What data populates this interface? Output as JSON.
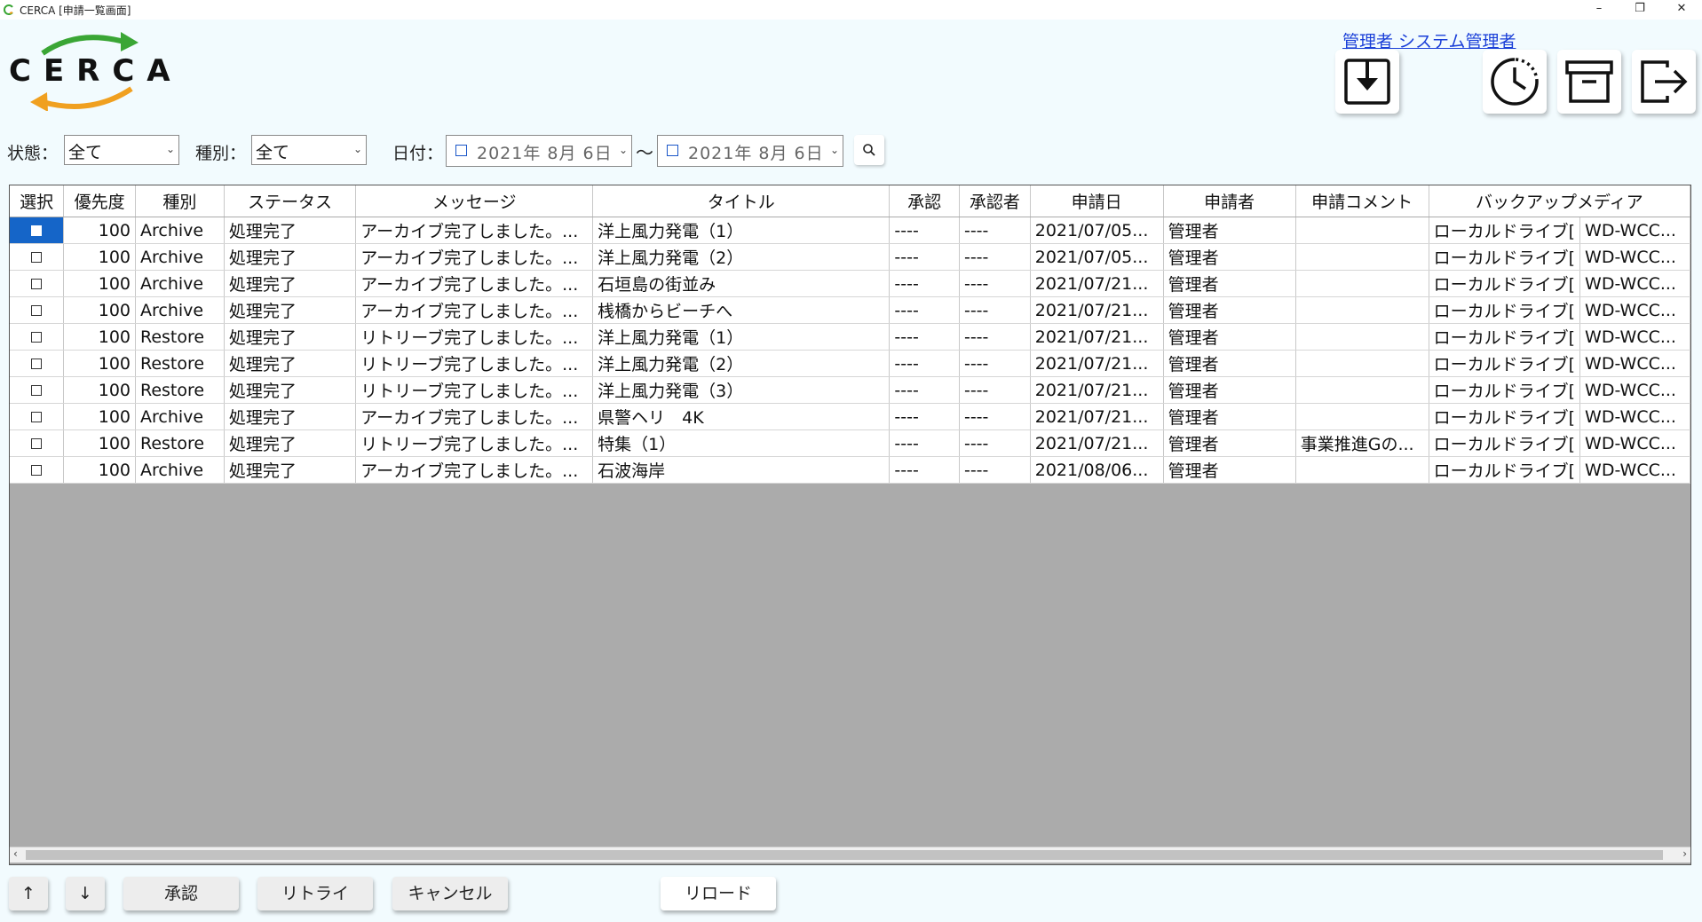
{
  "window": {
    "title": "CERCA [申請一覧画面]",
    "minimize_glyph": "–",
    "maximize_glyph": "❐",
    "close_glyph": "✕"
  },
  "logo": {
    "text": "CERCA"
  },
  "user": {
    "link": "管理者 システム管理者"
  },
  "toolbar": {
    "icons": [
      "download-icon",
      "history-icon",
      "archive-box-icon",
      "logout-icon"
    ]
  },
  "filters": {
    "status_label": "状態：",
    "status_value": "全て",
    "type_label": "種別：",
    "type_value": "全て",
    "date_label": "日付：",
    "date_from": "2021年  8月  6日",
    "date_sep": "〜",
    "date_to": "2021年  8月  6日"
  },
  "table": {
    "columns": [
      "選択",
      "優先度",
      "種別",
      "ステータス",
      "メッセージ",
      "タイトル",
      "承認",
      "承認者",
      "申請日",
      "申請者",
      "申請コメント",
      "バックアップメディア"
    ],
    "rows": [
      [
        "100",
        "Archive",
        "処理完了",
        "アーカイブ完了しました。...",
        "洋上風力発電（1）",
        "----",
        "----",
        "2021/07/05...",
        "管理者",
        "",
        "ローカルドライブ[",
        "WD-WCC..."
      ],
      [
        "100",
        "Archive",
        "処理完了",
        "アーカイブ完了しました。...",
        "洋上風力発電（2）",
        "----",
        "----",
        "2021/07/05...",
        "管理者",
        "",
        "ローカルドライブ[",
        "WD-WCC..."
      ],
      [
        "100",
        "Archive",
        "処理完了",
        "アーカイブ完了しました。...",
        "石垣島の街並み",
        "----",
        "----",
        "2021/07/21...",
        "管理者",
        "",
        "ローカルドライブ[",
        "WD-WCC..."
      ],
      [
        "100",
        "Archive",
        "処理完了",
        "アーカイブ完了しました。...",
        "桟橋からビーチへ",
        "----",
        "----",
        "2021/07/21...",
        "管理者",
        "",
        "ローカルドライブ[",
        "WD-WCC..."
      ],
      [
        "100",
        "Restore",
        "処理完了",
        "リトリーブ完了しました。...",
        "洋上風力発電（1）",
        "----",
        "----",
        "2021/07/21...",
        "管理者",
        "",
        "ローカルドライブ[",
        "WD-WCC..."
      ],
      [
        "100",
        "Restore",
        "処理完了",
        "リトリーブ完了しました。...",
        "洋上風力発電（2）",
        "----",
        "----",
        "2021/07/21...",
        "管理者",
        "",
        "ローカルドライブ[",
        "WD-WCC..."
      ],
      [
        "100",
        "Restore",
        "処理完了",
        "リトリーブ完了しました。...",
        "洋上風力発電（3）",
        "----",
        "----",
        "2021/07/21...",
        "管理者",
        "",
        "ローカルドライブ[",
        "WD-WCC..."
      ],
      [
        "100",
        "Archive",
        "処理完了",
        "アーカイブ完了しました。...",
        "県警ヘリ　4K",
        "----",
        "----",
        "2021/07/21...",
        "管理者",
        "",
        "ローカルドライブ[",
        "WD-WCC..."
      ],
      [
        "100",
        "Restore",
        "処理完了",
        "リトリーブ完了しました。...",
        "特集（1）",
        "----",
        "----",
        "2021/07/21...",
        "管理者",
        "事業推進Gの...",
        "ローカルドライブ[",
        "WD-WCC..."
      ],
      [
        "100",
        "Archive",
        "処理完了",
        "アーカイブ完了しました。...",
        "石波海岸",
        "----",
        "----",
        "2021/08/06...",
        "管理者",
        "",
        "ローカルドライブ[",
        "WD-WCC..."
      ]
    ],
    "selected_row": 0
  },
  "buttons": {
    "up": "↑",
    "down": "↓",
    "approve": "承認",
    "retry": "リトライ",
    "cancel": "キャンセル",
    "reload": "リロード"
  },
  "colors": {
    "background": "#f2fbfe",
    "selection": "#1565c8",
    "grid_empty": "#ababab",
    "link": "#1a3fd8",
    "logo_green": "#3aa635",
    "logo_orange": "#f0a020"
  }
}
